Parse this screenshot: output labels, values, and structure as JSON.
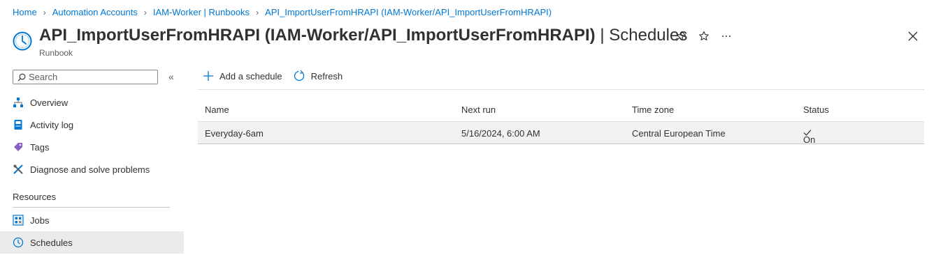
{
  "breadcrumb": [
    "Home",
    "Automation Accounts",
    "IAM-Worker | Runbooks",
    "API_ImportUserFromHRAPI (IAM-Worker/API_ImportUserFromHRAPI)"
  ],
  "header": {
    "title": "API_ImportUserFromHRAPI (IAM-Worker/API_ImportUserFromHRAPI)",
    "divider": " | ",
    "section": "Schedules",
    "subtitle": "Runbook",
    "icon": "clock-icon"
  },
  "sidebar": {
    "search_placeholder": "Search",
    "collapse_label": "«",
    "items": [
      {
        "label": "Overview",
        "icon": "overview-icon"
      },
      {
        "label": "Activity log",
        "icon": "activity-log-icon"
      },
      {
        "label": "Tags",
        "icon": "tag-icon"
      },
      {
        "label": "Diagnose and solve problems",
        "icon": "wrench-icon"
      }
    ],
    "section_label": "Resources",
    "resource_items": [
      {
        "label": "Jobs",
        "icon": "jobs-icon"
      },
      {
        "label": "Schedules",
        "icon": "clock-icon",
        "selected": true
      }
    ]
  },
  "toolbar": {
    "add_label": "Add a schedule",
    "refresh_label": "Refresh"
  },
  "table": {
    "headers": [
      "Name",
      "Next run",
      "Time zone",
      "Status"
    ],
    "rows": [
      {
        "name": "Everyday-6am",
        "next_run": "5/16/2024, 6:00 AM",
        "time_zone": "Central European Time",
        "status": "On"
      }
    ]
  },
  "colors": {
    "accent": "#0078d4",
    "selected_bg": "#edebe9",
    "row_bg": "#f3f2f1"
  }
}
